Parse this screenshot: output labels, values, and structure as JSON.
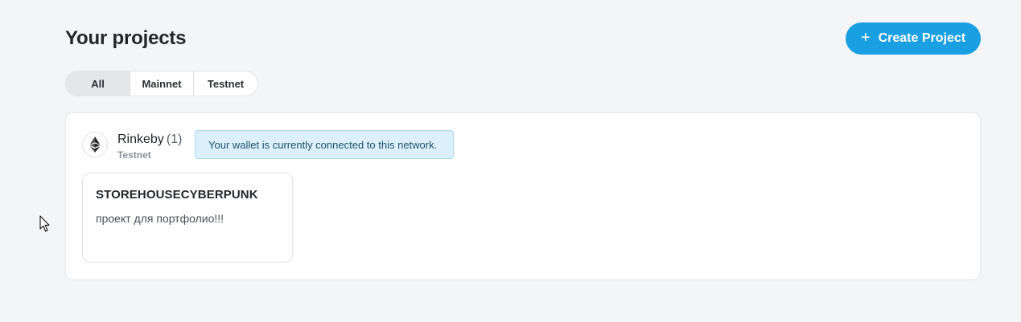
{
  "header": {
    "title": "Your projects",
    "create_label": "Create Project",
    "create_icon": "plus-icon"
  },
  "filters": {
    "tabs": [
      {
        "label": "All",
        "selected": true
      },
      {
        "label": "Mainnet",
        "selected": false
      },
      {
        "label": "Testnet",
        "selected": false
      }
    ]
  },
  "network": {
    "name": "Rinkeby",
    "count": "(1)",
    "type": "Testnet",
    "logo_icon": "ethereum-icon",
    "notice": "Your wallet is currently connected to this network.",
    "projects": [
      {
        "name": "STOREHOUSECYBERPUNK",
        "description": "проект для портфолио!!!"
      }
    ]
  },
  "colors": {
    "accent": "#1a9fe3",
    "background": "#f4f5f7",
    "notice_bg": "#dcf0fb"
  }
}
